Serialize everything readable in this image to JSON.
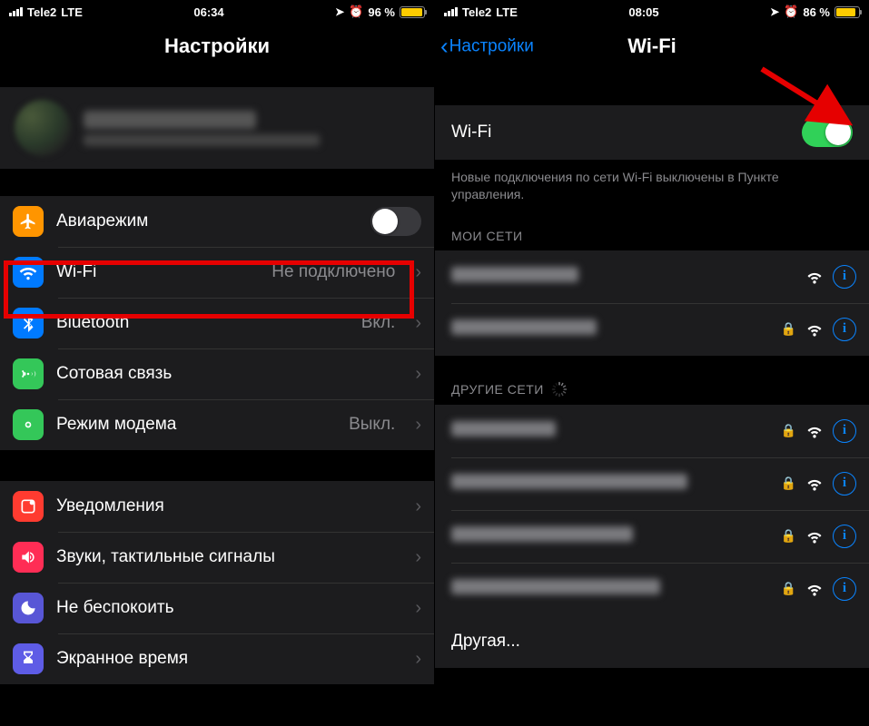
{
  "left": {
    "status": {
      "carrier": "Tele2",
      "net": "LTE",
      "time": "06:34",
      "battery_pct": "96 %"
    },
    "title": "Настройки",
    "rows": {
      "airplane": "Авиарежим",
      "wifi": "Wi-Fi",
      "wifi_value": "Не подключено",
      "bluetooth": "Bluetooth",
      "bluetooth_value": "Вкл.",
      "cellular": "Сотовая связь",
      "hotspot": "Режим модема",
      "hotspot_value": "Выкл.",
      "notifications": "Уведомления",
      "sounds": "Звуки, тактильные сигналы",
      "dnd": "Не беспокоить",
      "screentime": "Экранное время"
    }
  },
  "right": {
    "status": {
      "carrier": "Tele2",
      "net": "LTE",
      "time": "08:05",
      "battery_pct": "86 %"
    },
    "back_label": "Настройки",
    "title": "Wi-Fi",
    "wifi_label": "Wi-Fi",
    "note": "Новые подключения по сети Wi-Fi выключены в Пункте управления.",
    "my_networks_header": "МОИ СЕТИ",
    "other_networks_header": "ДРУГИЕ СЕТИ",
    "other_label": "Другая..."
  }
}
